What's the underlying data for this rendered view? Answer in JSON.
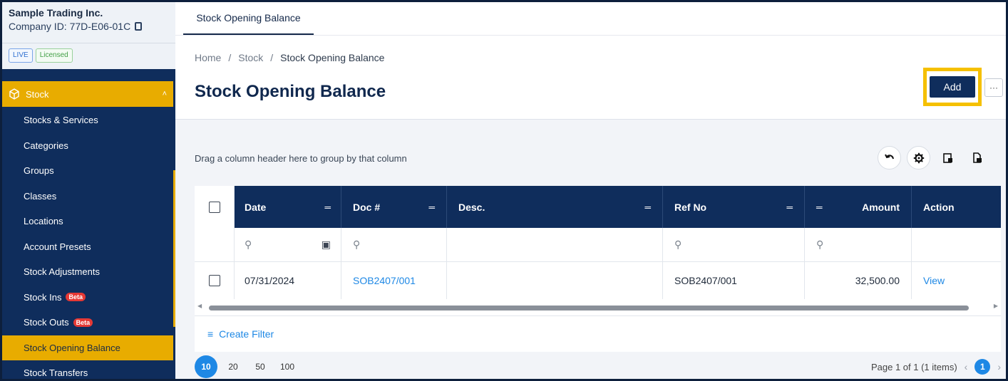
{
  "company": {
    "name": "Sample Trading Inc.",
    "id_label": "Company ID: 77D-E06-01C"
  },
  "badges": {
    "live": "LIVE",
    "licensed": "Licensed"
  },
  "sidebar": {
    "parent": "Stock",
    "items": [
      {
        "label": "Stocks & Services"
      },
      {
        "label": "Categories"
      },
      {
        "label": "Groups"
      },
      {
        "label": "Classes"
      },
      {
        "label": "Locations"
      },
      {
        "label": "Account Presets"
      },
      {
        "label": "Stock Adjustments"
      },
      {
        "label": "Stock Ins",
        "badge": "Beta"
      },
      {
        "label": "Stock Outs",
        "badge": "Beta"
      },
      {
        "label": "Stock Opening Balance",
        "active": true
      },
      {
        "label": "Stock Transfers"
      }
    ]
  },
  "tab": {
    "label": "Stock Opening Balance"
  },
  "breadcrumb": {
    "home": "Home",
    "sep": "/",
    "section": "Stock",
    "current": "Stock Opening Balance"
  },
  "page": {
    "title": "Stock Opening Balance",
    "add_label": "Add",
    "more_label": "···"
  },
  "grid": {
    "group_hint": "Drag a column header here to group by that column",
    "columns": {
      "date": "Date",
      "doc": "Doc #",
      "desc": "Desc.",
      "ref": "Ref No",
      "amount": "Amount",
      "action": "Action"
    },
    "rows": [
      {
        "date": "07/31/2024",
        "doc": "SOB2407/001",
        "desc": "",
        "ref": "SOB2407/001",
        "amount": "32,500.00",
        "action": "View"
      }
    ],
    "create_filter": "Create Filter"
  },
  "pager": {
    "sizes": [
      "10",
      "20",
      "50",
      "100"
    ],
    "selected_size": "10",
    "info": "Page 1 of 1 (1 items)",
    "current_page": "1"
  },
  "colors": {
    "navy": "#0f2d5c",
    "accent": "#e8ac00",
    "link": "#1e88e5"
  }
}
